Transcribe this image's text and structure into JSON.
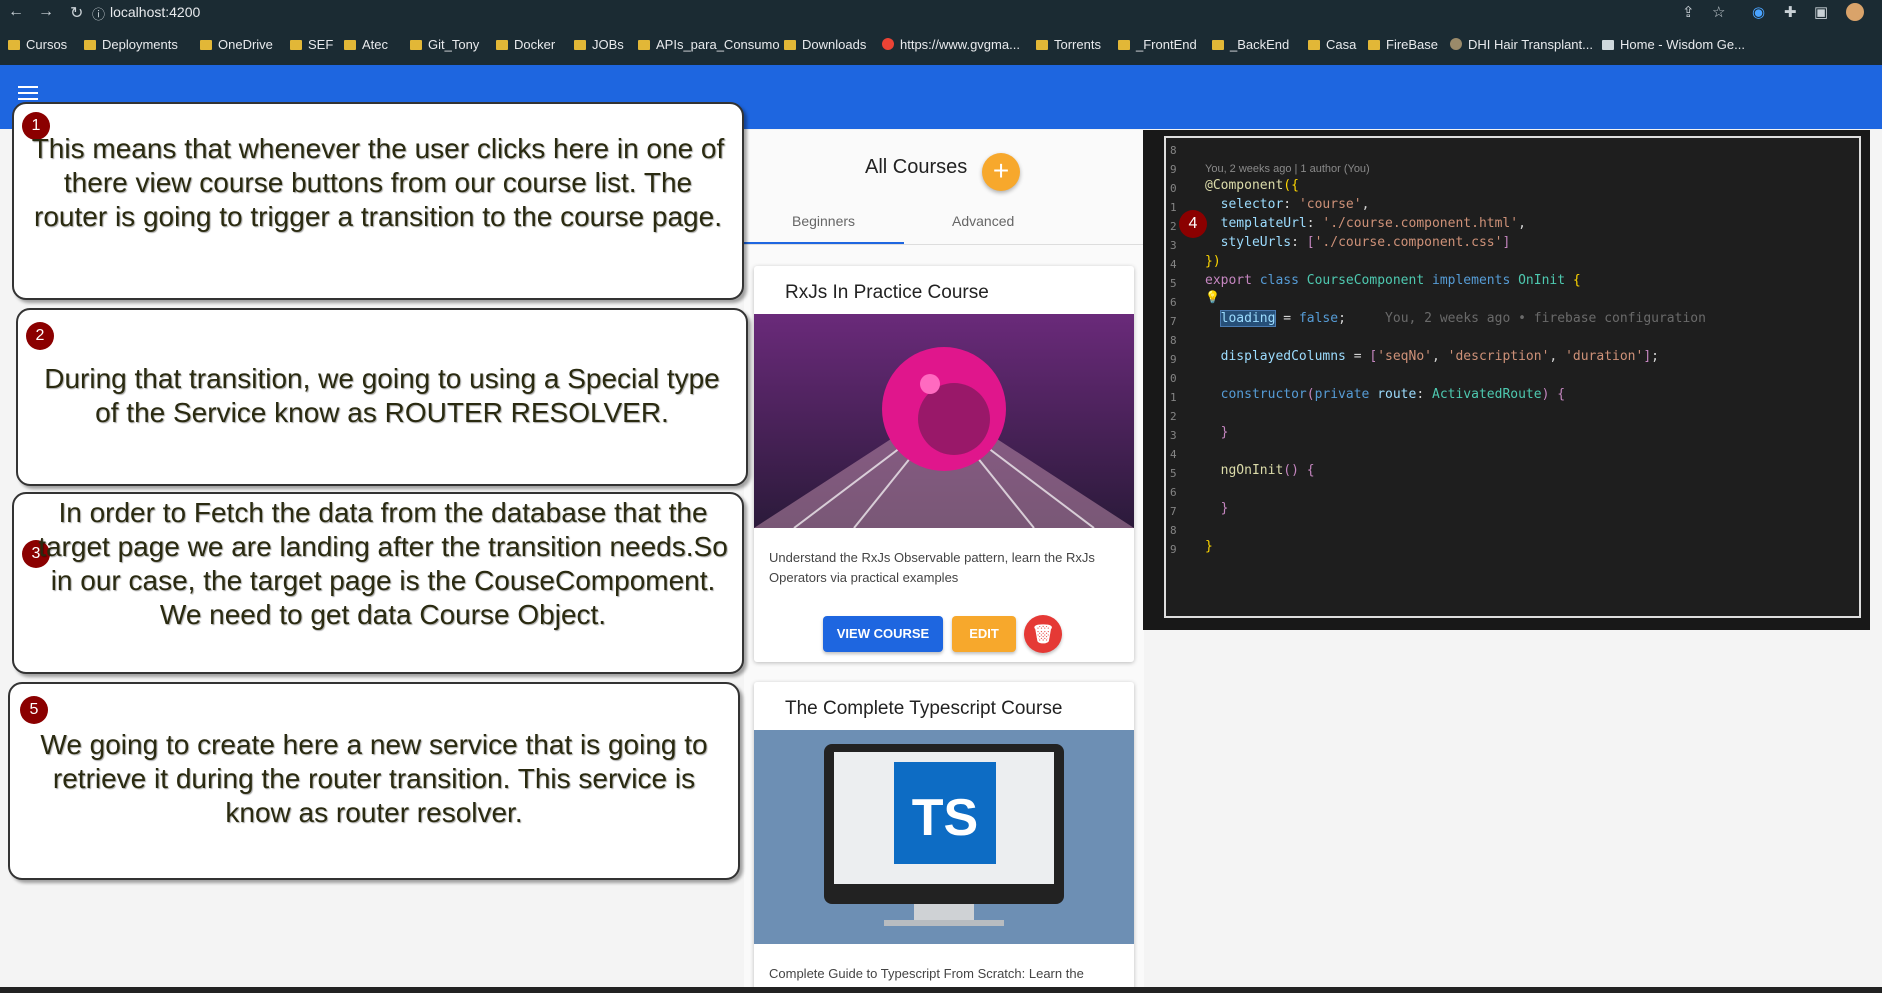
{
  "browser": {
    "url": "localhost:4200",
    "bookmarks": [
      "Cursos",
      "Deployments",
      "OneDrive",
      "SEF",
      "Atec",
      "Git_Tony",
      "Docker",
      "JOBs",
      "APIs_para_Consumo",
      "Downloads",
      "https://www.gvgma...",
      "Torrents",
      "_FrontEnd",
      "_BackEnd",
      "Casa",
      "FireBase",
      "DHI Hair Transplant...",
      "Home - Wisdom Ge..."
    ]
  },
  "app": {
    "title": "All Courses",
    "add_symbol": "+",
    "tabs": [
      "Beginners",
      "Advanced"
    ]
  },
  "courses": [
    {
      "title": "RxJs In Practice Course",
      "description": "Understand the RxJs Observable pattern, learn the RxJs Operators via practical examples",
      "view_label": "VIEW COURSE",
      "edit_label": "EDIT"
    },
    {
      "title": "The Complete Typescript Course",
      "image_text": "TS",
      "description": "Complete Guide to Typescript From Scratch: Learn the"
    }
  ],
  "code": {
    "blame_header": "You, 2 weeks ago | 1 author (You)",
    "inline_blame": "You, 2 weeks ago • firebase configuration",
    "line_numbers": [
      "8",
      "9",
      "0",
      "1",
      "2",
      "3",
      "4",
      "5",
      "6",
      "7",
      "8",
      "9",
      "0",
      "1",
      "2",
      "3",
      "4",
      "5",
      "6",
      "7",
      "8",
      "9"
    ]
  },
  "callouts": [
    {
      "number": "1",
      "text": "This means that whenever the user clicks here in one of there view course buttons from our course list. The router is going to trigger a transition to the course page."
    },
    {
      "number": "2",
      "text": "During that transition, we going to using a Special type of the Service know as ROUTER RESOLVER."
    },
    {
      "number": "3",
      "text": "In order to Fetch the data from the database that the target page we are landing after the transition needs.So in our case, the target page is the CouseCompoment. We need to get data Course Object."
    },
    {
      "number": "4"
    },
    {
      "number": "5",
      "text": "We going to create here a new service that is going to retrieve it during the router transition. This service is know as router resolver."
    }
  ],
  "colors": {
    "primary": "#1e66e0",
    "accent": "#f7a82c",
    "warn": "#e53935",
    "badge": "#8b0000"
  }
}
